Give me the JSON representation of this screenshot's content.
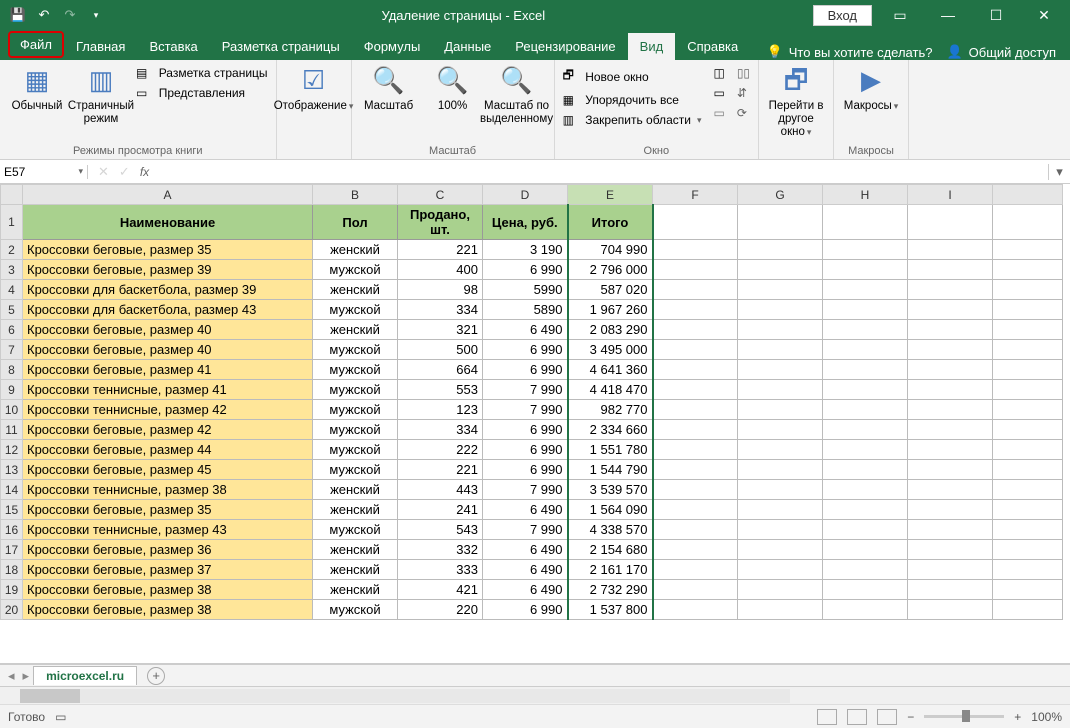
{
  "title": "Удаление страницы  -  Excel",
  "login": "Вход",
  "tabs": {
    "file": "Файл",
    "home": "Главная",
    "insert": "Вставка",
    "layout": "Разметка страницы",
    "formulas": "Формулы",
    "data": "Данные",
    "review": "Рецензирование",
    "view": "Вид",
    "help": "Справка"
  },
  "tellme": "Что вы хотите сделать?",
  "share": "Общий доступ",
  "ribbon": {
    "normal": "Обычный",
    "pagebreak": "Страничный режим",
    "pagelayout": "Разметка страницы",
    "views": "Представления",
    "viewsGroup": "Режимы просмотра книги",
    "show": "Отображение",
    "zoom": "Масштаб",
    "p100": "100%",
    "zoomSel": "Масштаб по выделенному",
    "zoomGroup": "Масштаб",
    "newWin": "Новое окно",
    "arrange": "Упорядочить все",
    "freeze": "Закрепить области",
    "windowGroup": "Окно",
    "switch": "Перейти в другое окно",
    "macros": "Макросы",
    "macrosGroup": "Макросы"
  },
  "namebox": "E57",
  "headers": {
    "a": "Наименование",
    "b": "Пол",
    "c": "Продано, шт.",
    "d": "Цена, руб.",
    "e": "Итого"
  },
  "cols": [
    "A",
    "B",
    "C",
    "D",
    "E",
    "F",
    "G",
    "H",
    "I"
  ],
  "rows": [
    {
      "n": 2,
      "name": "Кроссовки беговые, размер 35",
      "sex": "женский",
      "qty": "221",
      "price": "3 190",
      "total": "704 990"
    },
    {
      "n": 3,
      "name": "Кроссовки беговые, размер 39",
      "sex": "мужской",
      "qty": "400",
      "price": "6 990",
      "total": "2 796 000"
    },
    {
      "n": 4,
      "name": "Кроссовки для баскетбола, размер 39",
      "sex": "женский",
      "qty": "98",
      "price": "5990",
      "total": "587 020"
    },
    {
      "n": 5,
      "name": "Кроссовки для баскетбола, размер 43",
      "sex": "мужской",
      "qty": "334",
      "price": "5890",
      "total": "1 967 260"
    },
    {
      "n": 6,
      "name": "Кроссовки беговые, размер 40",
      "sex": "женский",
      "qty": "321",
      "price": "6 490",
      "total": "2 083 290"
    },
    {
      "n": 7,
      "name": "Кроссовки беговые, размер 40",
      "sex": "мужской",
      "qty": "500",
      "price": "6 990",
      "total": "3 495 000"
    },
    {
      "n": 8,
      "name": "Кроссовки беговые, размер 41",
      "sex": "мужской",
      "qty": "664",
      "price": "6 990",
      "total": "4 641 360"
    },
    {
      "n": 9,
      "name": "Кроссовки теннисные, размер 41",
      "sex": "мужской",
      "qty": "553",
      "price": "7 990",
      "total": "4 418 470"
    },
    {
      "n": 10,
      "name": "Кроссовки теннисные, размер 42",
      "sex": "мужской",
      "qty": "123",
      "price": "7 990",
      "total": "982 770"
    },
    {
      "n": 11,
      "name": "Кроссовки беговые, размер 42",
      "sex": "мужской",
      "qty": "334",
      "price": "6 990",
      "total": "2 334 660"
    },
    {
      "n": 12,
      "name": "Кроссовки беговые, размер 44",
      "sex": "мужской",
      "qty": "222",
      "price": "6 990",
      "total": "1 551 780"
    },
    {
      "n": 13,
      "name": "Кроссовки беговые, размер 45",
      "sex": "мужской",
      "qty": "221",
      "price": "6 990",
      "total": "1 544 790"
    },
    {
      "n": 14,
      "name": "Кроссовки теннисные, размер 38",
      "sex": "женский",
      "qty": "443",
      "price": "7 990",
      "total": "3 539 570"
    },
    {
      "n": 15,
      "name": "Кроссовки беговые, размер 35",
      "sex": "женский",
      "qty": "241",
      "price": "6 490",
      "total": "1 564 090"
    },
    {
      "n": 16,
      "name": "Кроссовки теннисные, размер 43",
      "sex": "мужской",
      "qty": "543",
      "price": "7 990",
      "total": "4 338 570"
    },
    {
      "n": 17,
      "name": "Кроссовки беговые, размер 36",
      "sex": "женский",
      "qty": "332",
      "price": "6 490",
      "total": "2 154 680"
    },
    {
      "n": 18,
      "name": "Кроссовки беговые, размер 37",
      "sex": "женский",
      "qty": "333",
      "price": "6 490",
      "total": "2 161 170"
    },
    {
      "n": 19,
      "name": "Кроссовки беговые, размер 38",
      "sex": "женский",
      "qty": "421",
      "price": "6 490",
      "total": "2 732 290"
    },
    {
      "n": 20,
      "name": "Кроссовки беговые, размер 38",
      "sex": "мужской",
      "qty": "220",
      "price": "6 990",
      "total": "1 537 800"
    }
  ],
  "sheet": "microexcel.ru",
  "status": "Готово",
  "zoomPct": "100%"
}
